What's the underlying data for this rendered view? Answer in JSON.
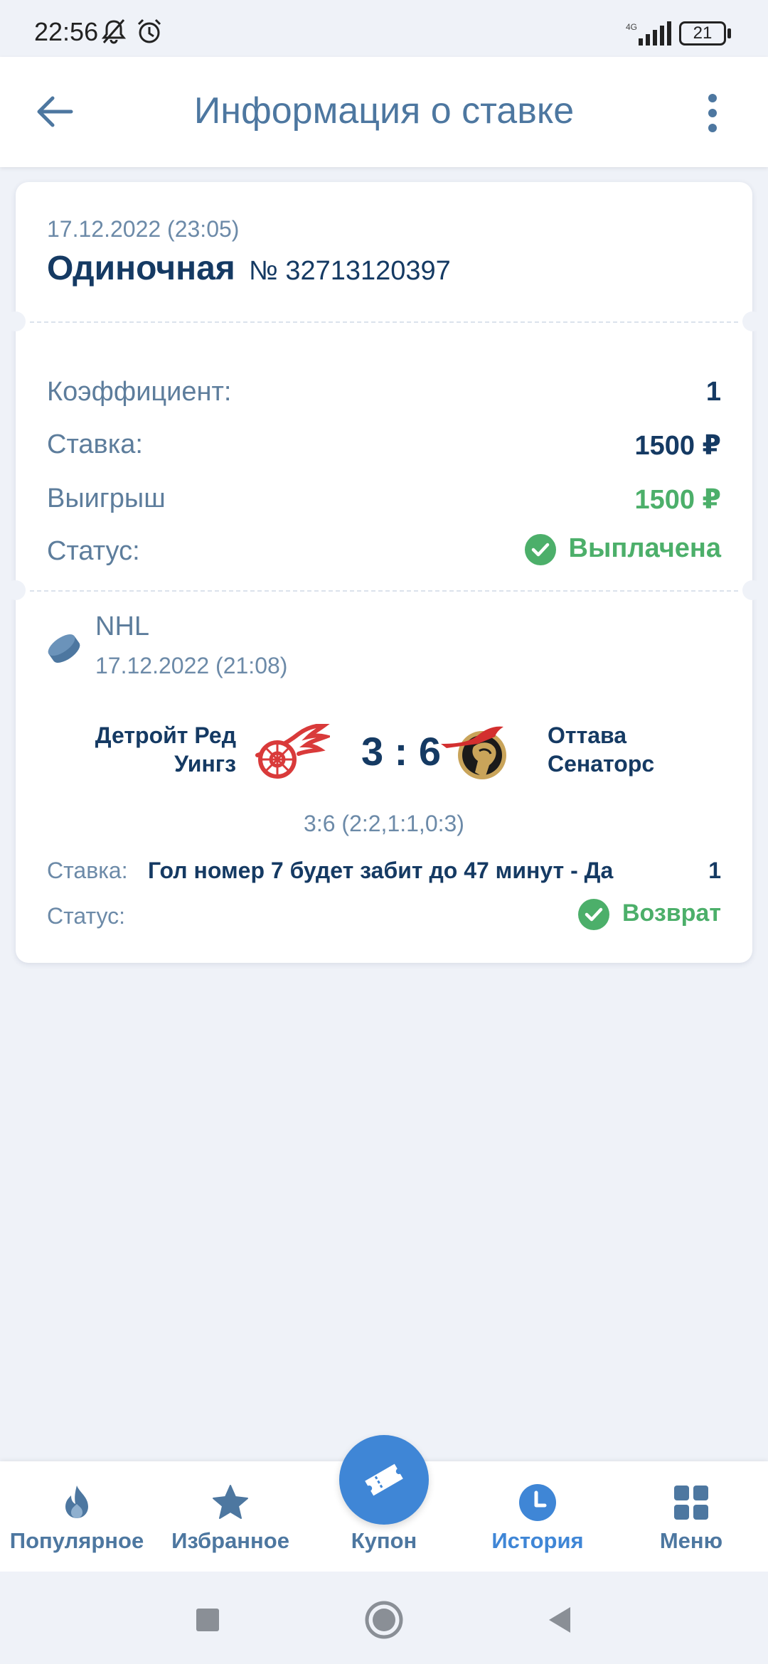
{
  "status_bar": {
    "time": "22:56",
    "network": "4G",
    "battery": "21"
  },
  "header": {
    "title": "Информация о ставке"
  },
  "bet": {
    "date": "17.12.2022 (23:05)",
    "type": "Одиночная",
    "number": "№ 32713120397",
    "rows": [
      {
        "label": "Коэффициент:",
        "value": "1"
      },
      {
        "label": "Ставка:",
        "value": "1500 ₽"
      },
      {
        "label": "Выигрыш",
        "value": "1500 ₽"
      },
      {
        "label": "Статус:",
        "value": "Выплачена"
      }
    ]
  },
  "event": {
    "league": "NHL",
    "date": "17.12.2022 (21:08)",
    "home_team": "Детройт Ред Уингз",
    "away_team": "Оттава Сенаторс",
    "score": "3 : 6",
    "periods": "3:6 (2:2,1:1,0:3)",
    "stake_label": "Ставка:",
    "stake_text": "Гол номер 7 будет забит до 47 минут - Да",
    "stake_coef": "1",
    "status_label": "Статус:",
    "status_value": "Возврат"
  },
  "bottom_nav": {
    "items": [
      {
        "label": "Популярное",
        "icon": "flame-icon"
      },
      {
        "label": "Избранное",
        "icon": "star-icon"
      },
      {
        "label": "Купон",
        "icon": "ticket-icon"
      },
      {
        "label": "История",
        "icon": "clock-icon"
      },
      {
        "label": "Меню",
        "icon": "grid-icon"
      }
    ]
  },
  "colors": {
    "accent": "#3f86d6",
    "title": "#4d77a0",
    "success": "#4caf6a",
    "text_dark": "#153a63",
    "background": "#eff2f8"
  }
}
